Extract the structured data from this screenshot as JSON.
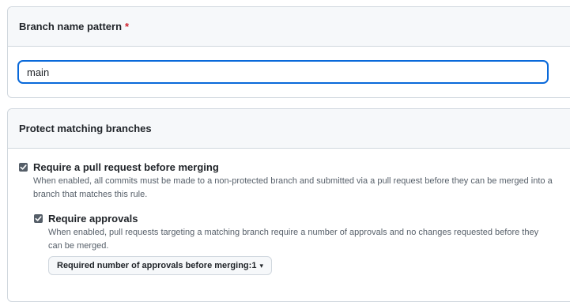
{
  "branch_pattern": {
    "label": "Branch name pattern",
    "required_mark": "*",
    "value": "main"
  },
  "protect": {
    "header": "Protect matching branches",
    "rules": [
      {
        "title": "Require a pull request before merging",
        "checked": true,
        "description": "When enabled, all commits must be made to a non-protected branch and submitted via a pull request before they can be merged into a branch that matches this rule."
      },
      {
        "title": "Require approvals",
        "checked": true,
        "description": "When enabled, pull requests targeting a matching branch require a number of approvals and no changes requested before they can be merged."
      }
    ],
    "approvals_select": {
      "label": "Required number of approvals before merging: ",
      "value": "1",
      "caret_icon": "triangle-down-icon"
    }
  }
}
